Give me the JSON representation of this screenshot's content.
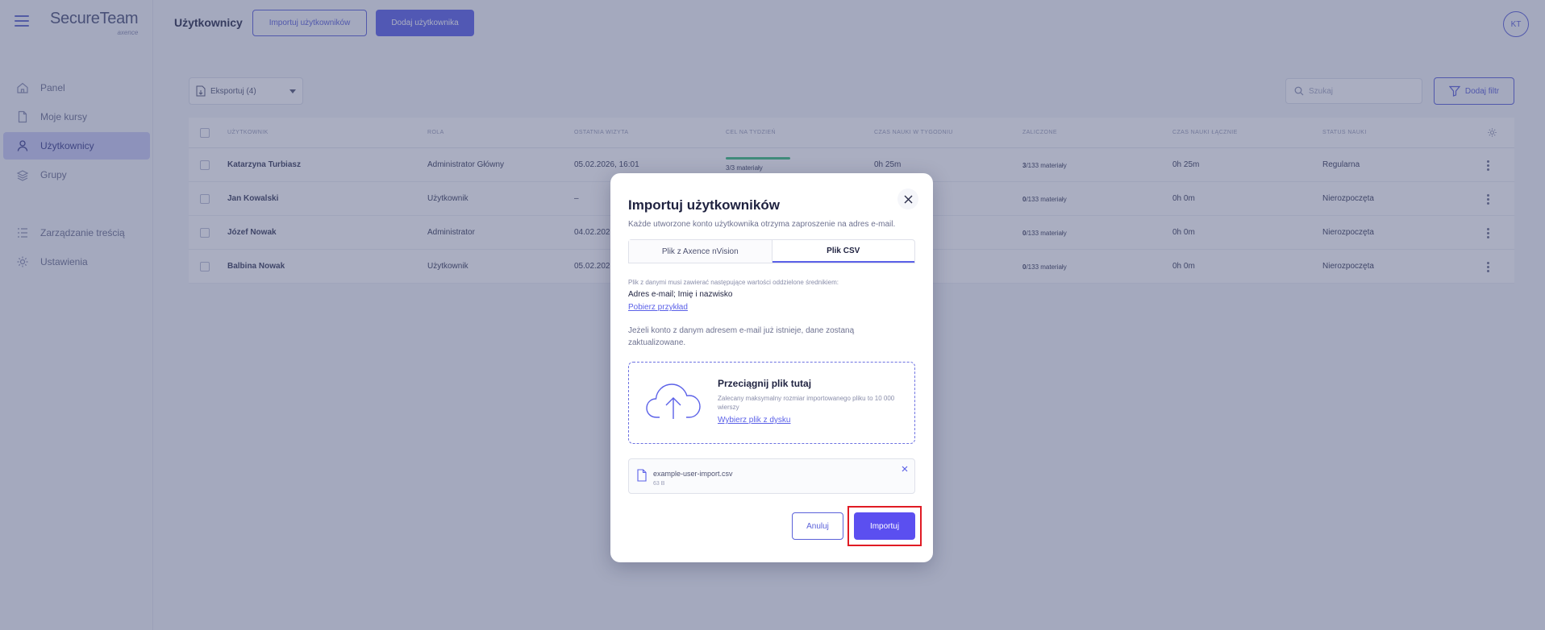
{
  "app": {
    "logo_main": "SecureTeam",
    "logo_sub": "axence"
  },
  "sidebar": {
    "items": [
      {
        "label": "Panel",
        "icon": "home-icon"
      },
      {
        "label": "Moje kursy",
        "icon": "document-icon"
      },
      {
        "label": "Użytkownicy",
        "icon": "user-icon",
        "active": true
      },
      {
        "label": "Grupy",
        "icon": "stack-icon"
      },
      {
        "label": "Zarządzanie treścią",
        "icon": "list-icon"
      },
      {
        "label": "Ustawienia",
        "icon": "gear-icon"
      }
    ]
  },
  "header": {
    "title": "Użytkownicy",
    "import_button": "Importuj użytkowników",
    "add_button": "Dodaj użytkownika",
    "avatar_initials": "KT"
  },
  "toolbar": {
    "export_label": "Eksportuj (4)",
    "search_placeholder": "Szukaj",
    "filter_label": "Dodaj filtr"
  },
  "table": {
    "columns": [
      "Użytkownik",
      "Rola",
      "Ostatnia wizyta",
      "Cel na tydzień",
      "Czas nauki w tygodniu",
      "Zaliczone",
      "Czas nauki łącznie",
      "Status nauki"
    ],
    "rows": [
      {
        "user": "Katarzyna Turbiasz",
        "role": "Administrator Główny",
        "visit": "05.02.2026, 16:01",
        "goal": "3/3 materiały",
        "weekly_time": "0h 25m",
        "passed_count": "3",
        "passed_total": "/133 materiały",
        "total_time": "0h 25m",
        "status": "Regularna",
        "goal_progress": 1.0
      },
      {
        "user": "Jan Kowalski",
        "role": "Użytkownik",
        "visit": "–",
        "goal": "",
        "weekly_time": "",
        "passed_count": "0",
        "passed_total": "/133 materiały",
        "total_time": "0h 0m",
        "status": "Nierozpoczęta"
      },
      {
        "user": "Józef Nowak",
        "role": "Administrator",
        "visit": "04.02.202",
        "goal": "",
        "weekly_time": "",
        "passed_count": "0",
        "passed_total": "/133 materiały",
        "total_time": "0h 0m",
        "status": "Nierozpoczęta"
      },
      {
        "user": "Balbina Nowak",
        "role": "Użytkownik",
        "visit": "05.02.202",
        "goal": "",
        "weekly_time": "",
        "passed_count": "0",
        "passed_total": "/133 materiały",
        "total_time": "0h 0m",
        "status": "Nierozpoczęta"
      }
    ]
  },
  "modal": {
    "title": "Importuj użytkowników",
    "subtitle": "Każde utworzone konto użytkownika otrzyma zaproszenie na adres e-mail.",
    "tabs": [
      {
        "label": "Plik z Axence nVision",
        "active": false
      },
      {
        "label": "Plik CSV",
        "active": true
      }
    ],
    "info_small": "Plik z danymi musi zawierać następujące wartości oddzielone średnikiem:",
    "info_fields": "Adres e-mail; Imię i nazwisko",
    "sample_link": "Pobierz przykład",
    "info_exists": "Jeżeli konto z danym adresem e-mail już istnieje, dane zostaną zaktualizowane.",
    "dropzone": {
      "title": "Przeciągnij plik tutaj",
      "hint": "Zalecany maksymalny rozmiar importowanego pliku to 10 000 wierszy",
      "link": "Wybierz plik z dysku"
    },
    "file": {
      "name": "example-user-import.csv",
      "size": "63 B"
    },
    "cancel_label": "Anuluj",
    "import_label": "Importuj"
  },
  "colors": {
    "accent": "#5b61e8",
    "highlight": "#e01b24",
    "success": "#3cbf7e"
  }
}
